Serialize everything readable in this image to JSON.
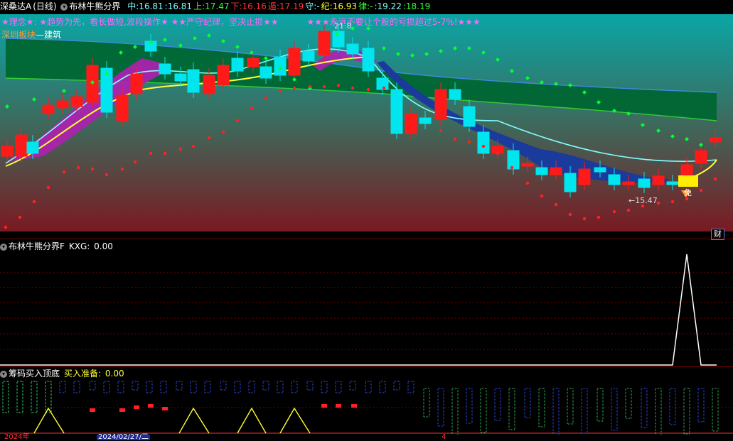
{
  "colors": {
    "up": "#ff1a1a",
    "down": "#00e5ee",
    "ma_fast": "#80ffff",
    "ma_slow": "#ffff33",
    "band_upper": "#0066cc",
    "band_fill": "#006633",
    "band_lower": "#33cc33",
    "dot_green": "#00ff33",
    "dot_red": "#ff2222"
  },
  "header": {
    "stock_name": "深桑达A",
    "period": "(日线)",
    "indicator_name": "布林牛熊分界",
    "items": [
      {
        "label": "中:",
        "value": "16.81",
        "color": "#80ffff"
      },
      {
        "label": ":",
        "value": "16.81",
        "color": "#80ffff"
      },
      {
        "label": "上:",
        "value": "17.47",
        "color": "#33ff33"
      },
      {
        "label": "下:",
        "value": "16.16",
        "color": "#ff3333"
      },
      {
        "label": "遁:",
        "value": "17.19",
        "color": "#ff3333"
      },
      {
        "label": "守:",
        "value": "-",
        "color": "#80ffff"
      },
      {
        "label": "纪:",
        "value": "16.93",
        "color": "#ffff33"
      },
      {
        "label": "律:",
        "value": "-",
        "color": "#33ff33"
      },
      {
        "label": ":",
        "value": "19.22",
        "color": "#80ffff"
      },
      {
        "label": ":",
        "value": "18.19",
        "color": "#33ff33"
      }
    ]
  },
  "slogan": {
    "part1": "★理念★:",
    "part2": "★趋势为先，看长做短,波段操作★",
    "part3": "★★严守纪律，坚决止损★★",
    "part4": "★★★永远不要让个股的亏损超过5-7%!★★★"
  },
  "sector": {
    "label": "深圳板块",
    "sep": "—",
    "value": "建筑"
  },
  "annotations": {
    "high": "21.8",
    "low": "←15.47",
    "marker": "免",
    "finance_badge": "财"
  },
  "sub1": {
    "title": "布林牛熊分界F",
    "label": "KXG:",
    "value": "0.00"
  },
  "sub2": {
    "title": "筹码买入顶底",
    "label": "买入准备:",
    "value": "0.00"
  },
  "axis": {
    "year": "2024年",
    "date": "2024/02/27/二",
    "tick": "4"
  }
}
